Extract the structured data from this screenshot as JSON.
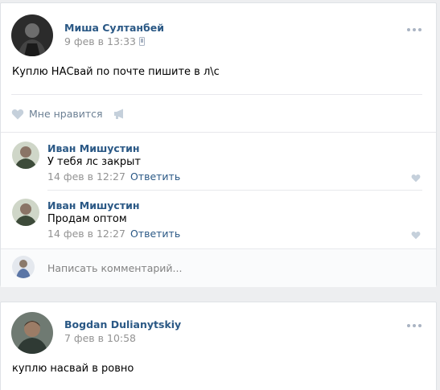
{
  "posts": [
    {
      "author": "Миша Султанбей",
      "date": "9 фев в 13:33",
      "text": "Куплю НАСвай по почте пишите в л\\с",
      "like_label": "Мне нравится",
      "comments": [
        {
          "author": "Иван Мишустин",
          "text": "У тебя лс закрыт",
          "date": "14 фев в 12:27",
          "reply_label": "Ответить"
        },
        {
          "author": "Иван Мишустин",
          "text": "Продам оптом",
          "date": "14 фев в 12:27",
          "reply_label": "Ответить"
        }
      ],
      "comment_placeholder": "Написать комментарий..."
    },
    {
      "author": "Bogdan Dulianytskiy",
      "date": "7 фев в 10:58",
      "text": "куплю насвай в ровно"
    }
  ],
  "colors": {
    "link": "#2a5885",
    "muted": "#939393",
    "icon": "#aab4c3",
    "bg": "#edeef0"
  },
  "icons": [
    "phone-icon",
    "more-icon",
    "heart-icon",
    "megaphone-icon"
  ]
}
